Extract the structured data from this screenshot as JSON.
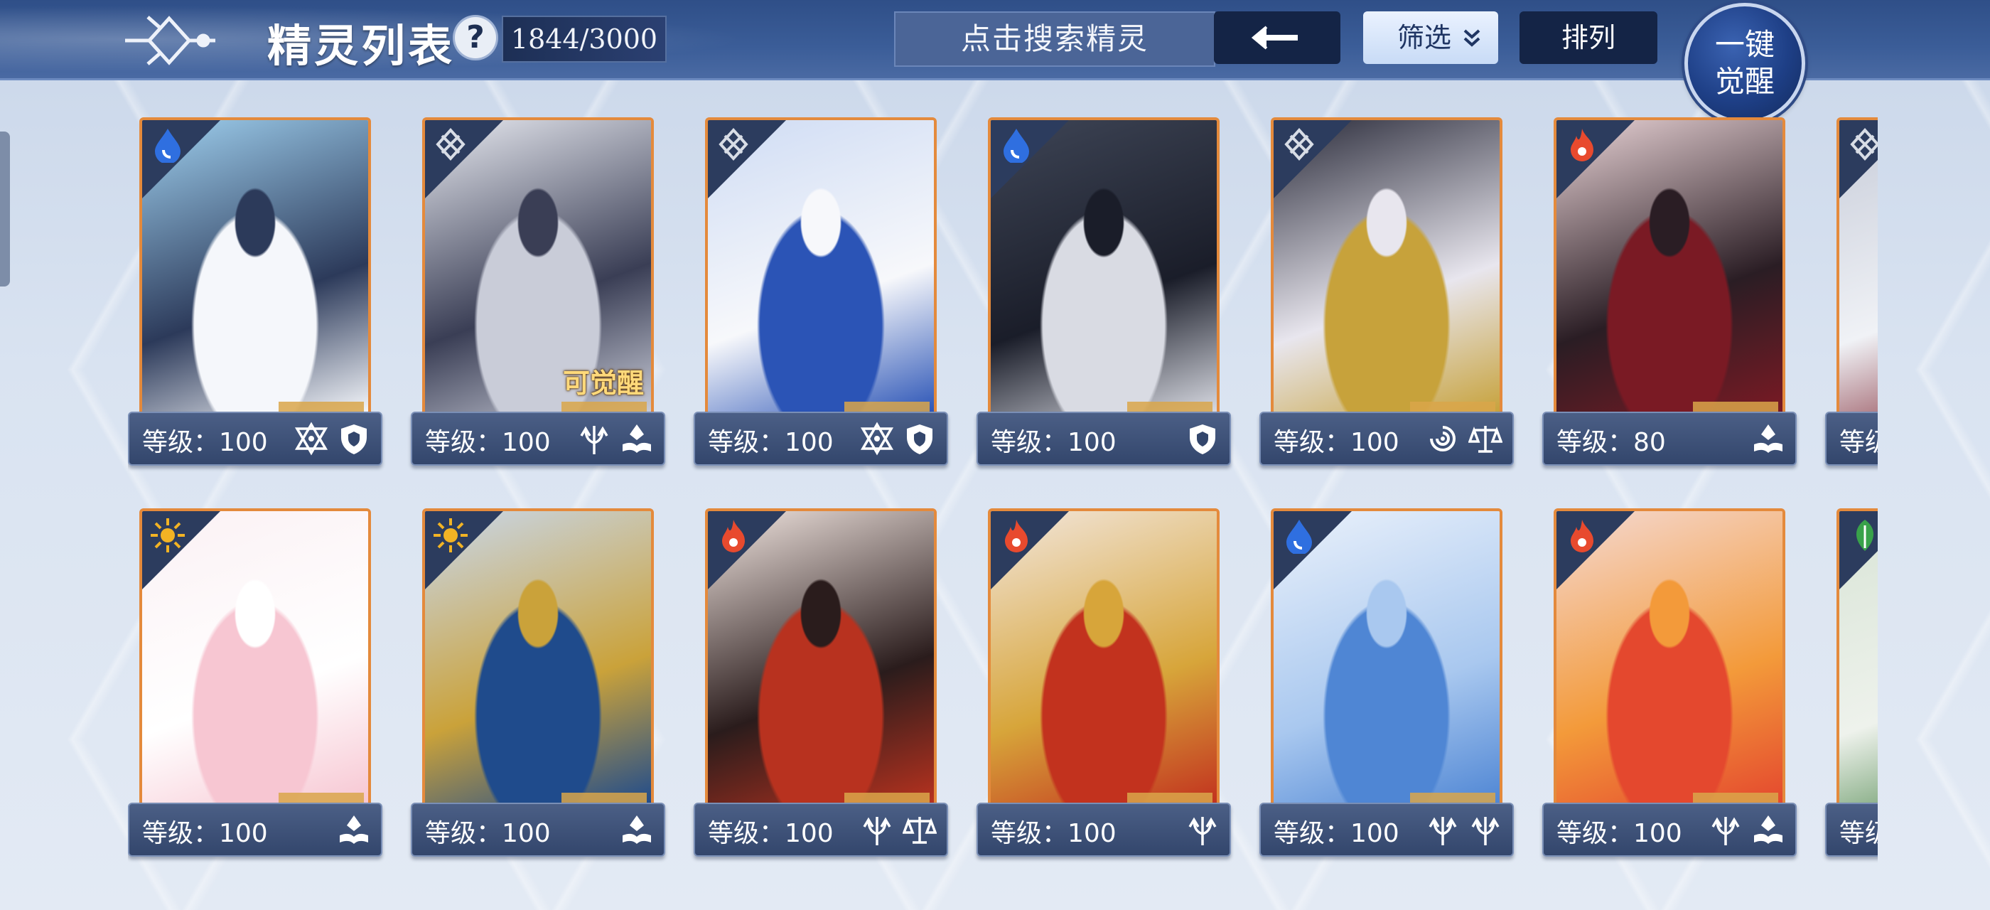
{
  "header": {
    "title": "精灵列表",
    "help": "?",
    "count": "1844/3000",
    "search_placeholder": "点击搜索精灵",
    "filter_label": "筛选",
    "sort_label": "排列",
    "awaken_all": [
      "一键",
      "觉醒"
    ]
  },
  "colors": {
    "water": "#2f6fe0",
    "fire": "#e84a2e",
    "light": "#f2b324",
    "grass": "#39a24a",
    "neutral": "#d8dde6"
  },
  "cards": [
    {
      "element": "water",
      "level_text": "等级：100",
      "badges": [
        "star-emblem-icon",
        "shield-icon"
      ],
      "palette": [
        "#9fd0ef",
        "#f5f7fb",
        "#2c3a5a"
      ]
    },
    {
      "element": "neutral",
      "level_text": "等级：100",
      "badges": [
        "trident-icon",
        "book-icon"
      ],
      "palette": [
        "#e7e9f0",
        "#c9ccd8",
        "#3a3e55"
      ],
      "awaken_tag": "可觉醒"
    },
    {
      "element": "neutral",
      "level_text": "等级：100",
      "badges": [
        "star-emblem-icon",
        "shield-icon"
      ],
      "palette": [
        "#cfdcf4",
        "#2b54b6",
        "#f7f8fb"
      ]
    },
    {
      "element": "water",
      "level_text": "等级：100",
      "badges": [
        "shield-icon"
      ],
      "palette": [
        "#3e4556",
        "#d9dbe3",
        "#1a1d29"
      ]
    },
    {
      "element": "neutral",
      "level_text": "等级：100",
      "badges": [
        "vortex-icon",
        "scales-icon"
      ],
      "palette": [
        "#2a2b3a",
        "#c7a23b",
        "#e8e6ee"
      ]
    },
    {
      "element": "fire",
      "level_text": "等级：80",
      "badges": [
        "book-icon"
      ],
      "palette": [
        "#e9d3d6",
        "#7a1a24",
        "#2a1d24"
      ]
    },
    {
      "element": "neutral",
      "level_text": "等级",
      "badges": [],
      "palette": [
        "#c7ccd9",
        "#7a1e2a",
        "#f0f2f6"
      ]
    },
    {
      "element": "light",
      "level_text": "等级：100",
      "badges": [
        "book-icon"
      ],
      "palette": [
        "#fbf1f4",
        "#f7c6d2",
        "#ffffff"
      ]
    },
    {
      "element": "light",
      "level_text": "等级：100",
      "badges": [
        "book-icon"
      ],
      "palette": [
        "#c9d7ea",
        "#1f4b8c",
        "#caa23a"
      ]
    },
    {
      "element": "fire",
      "level_text": "等级：100",
      "badges": [
        "trident-icon",
        "scales-icon"
      ],
      "palette": [
        "#f1e5e0",
        "#b8321f",
        "#2a1c1c"
      ]
    },
    {
      "element": "fire",
      "level_text": "等级：100",
      "badges": [
        "trident-icon"
      ],
      "palette": [
        "#f2e6dc",
        "#c2321e",
        "#d7a53a"
      ]
    },
    {
      "element": "water",
      "level_text": "等级：100",
      "badges": [
        "trident-icon",
        "trident-icon"
      ],
      "palette": [
        "#eaf1fb",
        "#4f86d4",
        "#a9c8ef"
      ]
    },
    {
      "element": "fire",
      "level_text": "等级：100",
      "badges": [
        "trident-icon",
        "book-icon"
      ],
      "palette": [
        "#f4d9d2",
        "#e4482e",
        "#f39a3a"
      ]
    },
    {
      "element": "grass",
      "level_text": "等级",
      "badges": [],
      "palette": [
        "#d8e4d6",
        "#3f7d3e",
        "#eef2ec"
      ]
    }
  ]
}
